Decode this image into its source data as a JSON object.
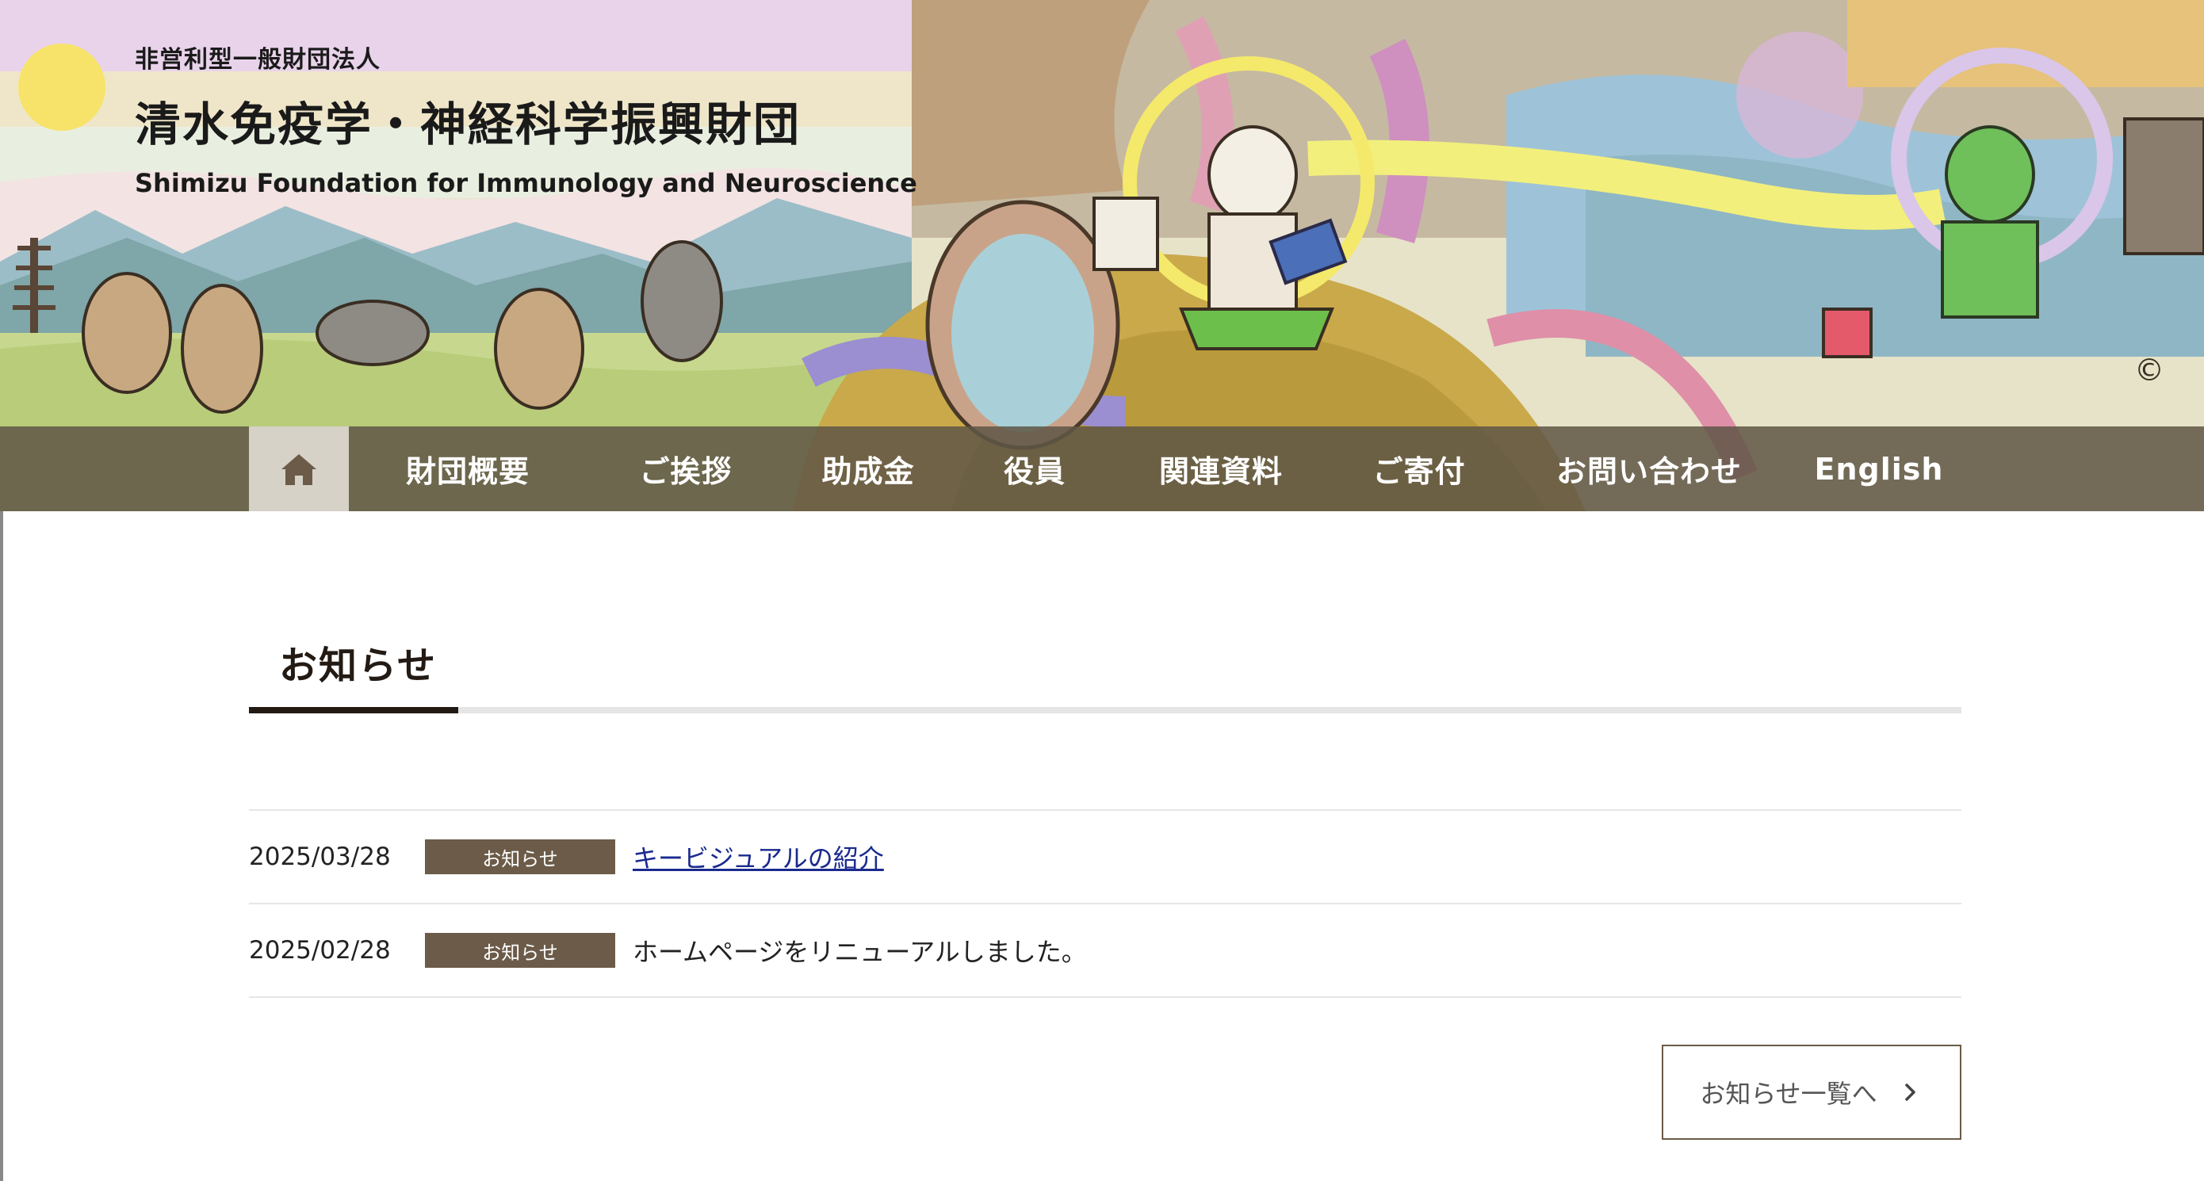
{
  "header": {
    "org_type": "非営利型一般財団法人",
    "title_ja": "清水免疫学・神経科学振興財団",
    "title_en": "Shimizu Foundation for Immunology and Neuroscience",
    "banner_icon": "illustrated-banner",
    "copyright_mark": "©"
  },
  "nav": {
    "home_icon": "home-icon",
    "items": [
      {
        "label": "財団概要"
      },
      {
        "label": "ご挨拶"
      },
      {
        "label": "助成金"
      },
      {
        "label": "役員"
      },
      {
        "label": "関連資料"
      },
      {
        "label": "ご寄付"
      },
      {
        "label": "お問い合わせ"
      },
      {
        "label": "English"
      }
    ]
  },
  "news": {
    "section_title": "お知らせ",
    "items": [
      {
        "date": "2025/03/28",
        "category": "お知らせ",
        "title": "キービジュアルの紹介"
      },
      {
        "date": "2025/02/28",
        "category": "お知らせ",
        "title": "ホームページをリニューアルしました。"
      }
    ],
    "more_label": "お知らせ一覧へ"
  },
  "colors": {
    "nav_bg": "#605646",
    "badge_bg": "#6b5b48",
    "accent": "#231a14",
    "link": "#1a2a8e"
  }
}
